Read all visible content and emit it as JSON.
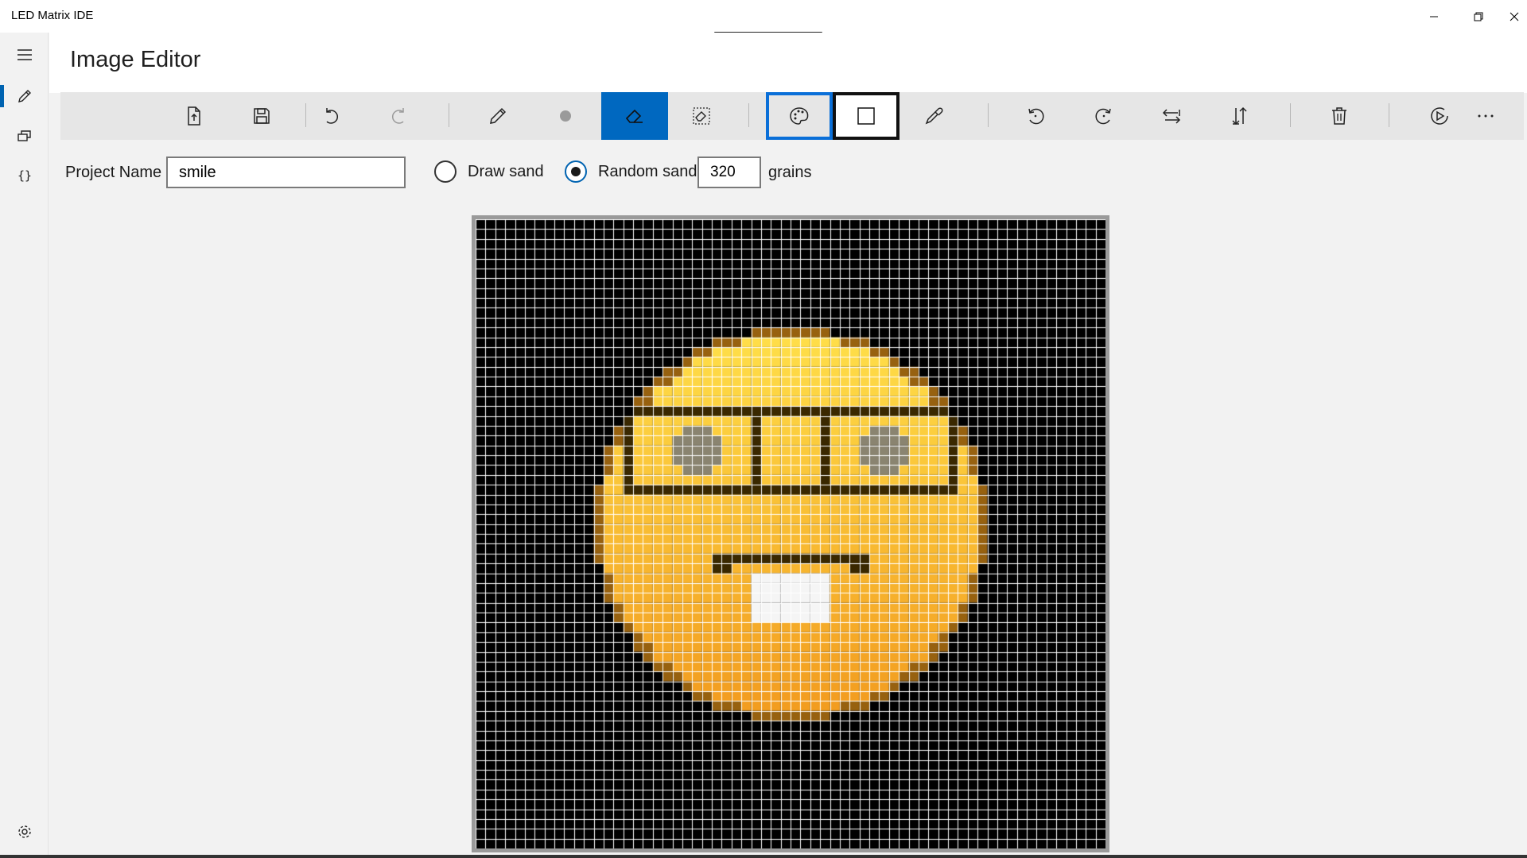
{
  "window": {
    "title": "LED Matrix IDE",
    "minimize_icon": "minimize-icon",
    "restore_icon": "restore-icon",
    "close_icon": "close-icon"
  },
  "nav": {
    "items": [
      {
        "icon": "hamburger-icon"
      },
      {
        "icon": "pencil-icon",
        "selected": true
      },
      {
        "icon": "frames-icon"
      },
      {
        "icon": "braces-icon"
      }
    ],
    "settings_icon": "gear-icon"
  },
  "header": {
    "title": "Image Editor"
  },
  "toolbar": {
    "buttons": [
      {
        "icon": "new-file-icon"
      },
      {
        "icon": "save-icon"
      },
      {
        "icon": "undo-icon"
      },
      {
        "icon": "redo-icon",
        "disabled": true
      },
      {
        "icon": "pencil-icon"
      },
      {
        "icon": "dot-icon",
        "disabled": true
      },
      {
        "icon": "eraser-icon",
        "active": true
      },
      {
        "icon": "clear-icon"
      },
      {
        "icon": "palette-icon",
        "selected": true
      },
      {
        "icon": "color-swatch-icon"
      },
      {
        "icon": "eyedropper-icon"
      },
      {
        "icon": "rotate-left-icon"
      },
      {
        "icon": "rotate-right-icon"
      },
      {
        "icon": "flip-horizontal-icon"
      },
      {
        "icon": "flip-vertical-icon"
      },
      {
        "icon": "delete-icon"
      },
      {
        "icon": "play-icon"
      },
      {
        "icon": "more-icon"
      }
    ],
    "active_color": "#0068c0"
  },
  "options": {
    "project_name_label": "Project Name",
    "project_name_value": "smile",
    "draw_sand_label": "Draw sand",
    "draw_sand_selected": false,
    "random_sand_label": "Random sand",
    "random_sand_selected": true,
    "grains_value": "320",
    "grains_label": "grains"
  },
  "matrix": {
    "columns": 64,
    "rows": 64,
    "background_color": "#000000",
    "grid_color": "#ffffff",
    "image": "smiling-face-emoji",
    "colors": {
      "face_top": "#ffe04a",
      "face_bottom": "#f29a1e",
      "outline": "#3a2800",
      "eye": "#8a8470",
      "teeth": "#f5f5f5"
    }
  }
}
